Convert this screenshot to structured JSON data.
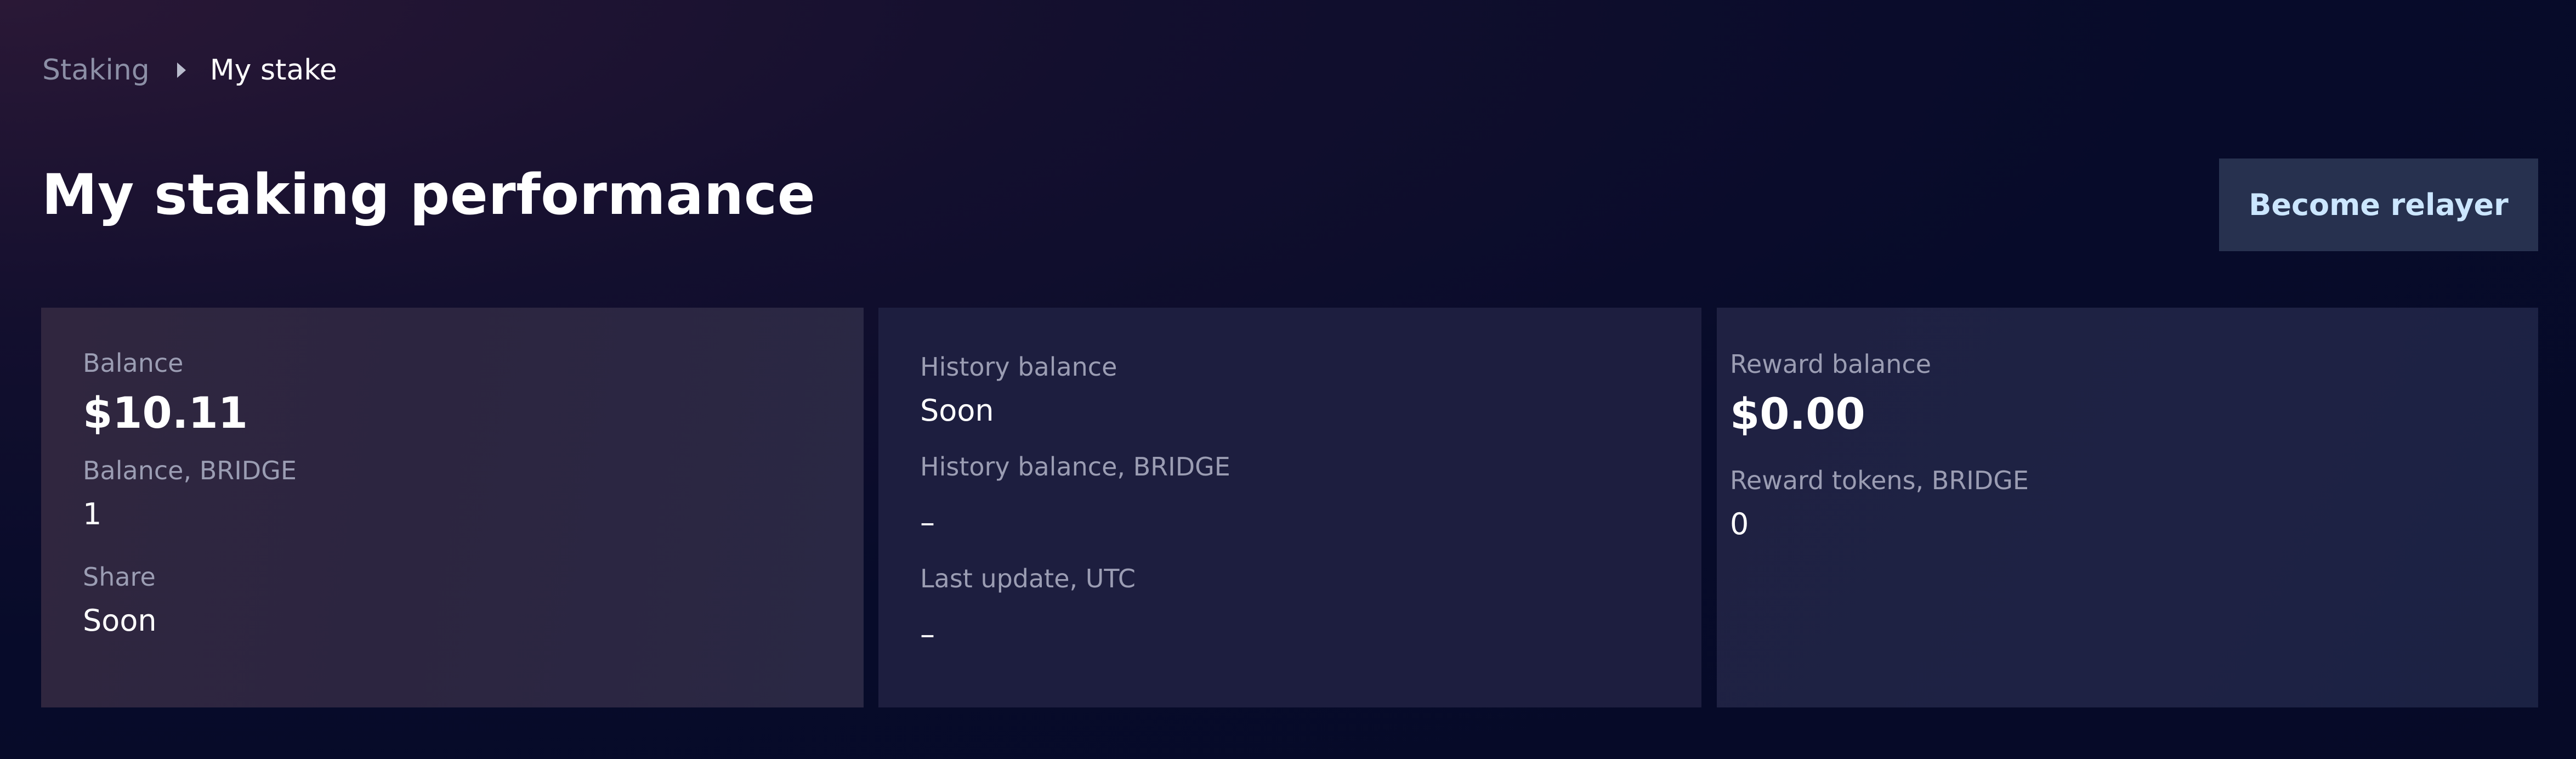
{
  "breadcrumb": {
    "parent": "Staking",
    "current": "My stake"
  },
  "page": {
    "title": "My staking performance",
    "become_relayer_label": "Become relayer"
  },
  "cards": {
    "balance_card": {
      "balance_label": "Balance",
      "balance_value": "$10.11",
      "balance_bridge_label": "Balance, BRIDGE",
      "balance_bridge_value": "1",
      "share_label": "Share",
      "share_value": "Soon"
    },
    "history_card": {
      "history_balance_label": "History balance",
      "history_balance_value": "Soon",
      "history_bridge_label": "History balance, BRIDGE",
      "history_bridge_value": "–",
      "last_update_label": "Last update, UTC",
      "last_update_value": "–"
    },
    "reward_card": {
      "reward_balance_label": "Reward balance",
      "reward_balance_value": "$0.00",
      "reward_tokens_label": "Reward tokens, BRIDGE",
      "reward_tokens_value": "0"
    }
  },
  "colors": {
    "background": "#070b2a",
    "button_bg": "#27314f",
    "button_text": "#cbe6ff",
    "muted_text": "#9b9db3"
  },
  "icons": {
    "breadcrumb_separator": "chevron-right-icon"
  }
}
